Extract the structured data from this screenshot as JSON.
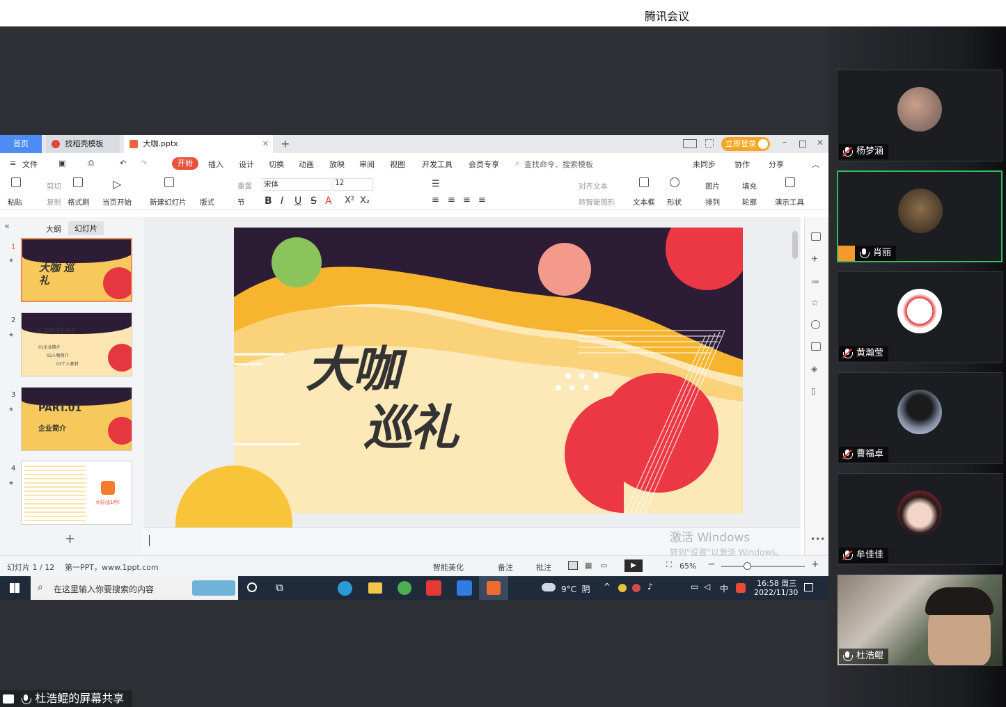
{
  "app_title": "腾讯会议",
  "screen_share_label": "杜浩鲲的屏幕共享",
  "participants": [
    {
      "name": "杨梦涵",
      "muted": true
    },
    {
      "name": "肖丽",
      "muted": false,
      "active": true
    },
    {
      "name": "黄瀚莹",
      "muted": true
    },
    {
      "name": "曹福卓",
      "muted": true
    },
    {
      "name": "牟佳佳",
      "muted": true
    },
    {
      "name": "杜浩鲲",
      "muted": false
    }
  ],
  "wps": {
    "tabs": {
      "home": "首页",
      "template": "找稻壳模板",
      "file": "大咖.pptx"
    },
    "login_button": "立即登录",
    "menu": {
      "file": "文件",
      "items": [
        "开始",
        "插入",
        "设计",
        "切换",
        "动画",
        "放映",
        "审阅",
        "视图",
        "开发工具",
        "会员专享"
      ],
      "search_placeholder": "查找命令、搜索模板",
      "sync": "未同步",
      "collab": "协作",
      "share": "分享"
    },
    "toolbar": {
      "paste": "粘贴",
      "cut": "剪切",
      "copy": "复制",
      "format_painter": "格式刷",
      "play_from_current": "当页开始",
      "new_slide": "新建幻灯片",
      "layout": "版式",
      "section": "节",
      "reset": "重置",
      "font": "宋体",
      "font_size": "12",
      "align_text": "对齐文本",
      "smart_shape": "转智能图形",
      "textbox": "文本框",
      "shape": "形状",
      "picture": "图片",
      "fill": "填充",
      "arrange": "排列",
      "outline": "轮廓",
      "present_tools": "演示工具"
    },
    "panel_tabs": {
      "outline": "大纲",
      "slides": "幻灯片"
    },
    "thumbnails": [
      {
        "num": "1",
        "text": "大咖 巡礼"
      },
      {
        "num": "2",
        "text": "CONTENT",
        "items": [
          "01企业简介",
          "02人物简介",
          "03个人素材"
        ]
      },
      {
        "num": "3",
        "text": "PART.01",
        "sub": "企业简介"
      },
      {
        "num": "4",
        "text": "大好战1吧!"
      }
    ],
    "slide": {
      "title_line1": "大咖",
      "title_line2": "巡礼"
    },
    "watermark": {
      "line1": "激活 Windows",
      "line2": "转到\"设置\"以激活 Windows。"
    },
    "status": {
      "slide_pos": "幻灯片 1 / 12",
      "theme": "第一PPT，www.1ppt.com",
      "beautify": "智能美化",
      "notes": "备注",
      "comment": "批注",
      "zoom": "65%"
    }
  },
  "taskbar": {
    "search_placeholder": "在这里输入你要搜索的内容",
    "weather": "9°C  阴",
    "ime": "中",
    "time": "16:58 周三",
    "date": "2022/11/30"
  }
}
